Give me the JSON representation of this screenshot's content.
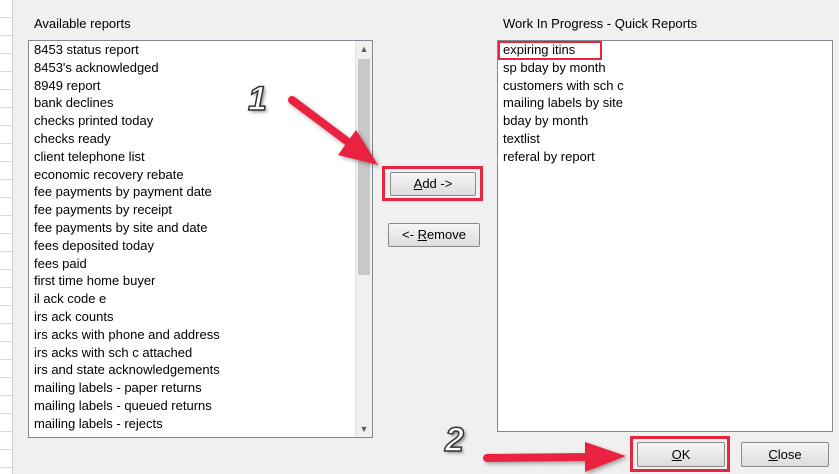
{
  "available": {
    "label": "Available reports",
    "items": [
      "8453 status report",
      "8453's acknowledged",
      "8949 report",
      "bank declines",
      "checks printed today",
      "checks ready",
      "client telephone list",
      "economic recovery rebate",
      "fee payments by payment date",
      "fee payments by receipt",
      "fee payments by site and date",
      "fees deposited today",
      "fees paid",
      "first time home buyer",
      "il ack code e",
      "irs ack counts",
      "irs acks with phone and address",
      "irs acks with sch c attached",
      "irs and state acknowledgements",
      "mailing labels - paper returns",
      "mailing labels - queued returns",
      "mailing labels - rejects"
    ]
  },
  "wip": {
    "label": "Work In Progress - Quick Reports",
    "items": [
      "expiring itins",
      "sp bday by month",
      "customers with sch c",
      "mailing labels by site",
      "bday by month",
      "textlist",
      "referal by report"
    ]
  },
  "buttons": {
    "add": {
      "accel": "A",
      "rest": "dd ->"
    },
    "remove": {
      "prefix": "<- ",
      "accel": "R",
      "rest": "emove"
    },
    "ok": {
      "accel": "O",
      "rest": "K"
    },
    "close": {
      "accel": "C",
      "rest": "lose"
    }
  },
  "annotations": {
    "step1": "1",
    "step2": "2",
    "highlight_color": "#e8243f"
  },
  "icons": {
    "scroll_up": "▲",
    "scroll_down": "▼"
  }
}
